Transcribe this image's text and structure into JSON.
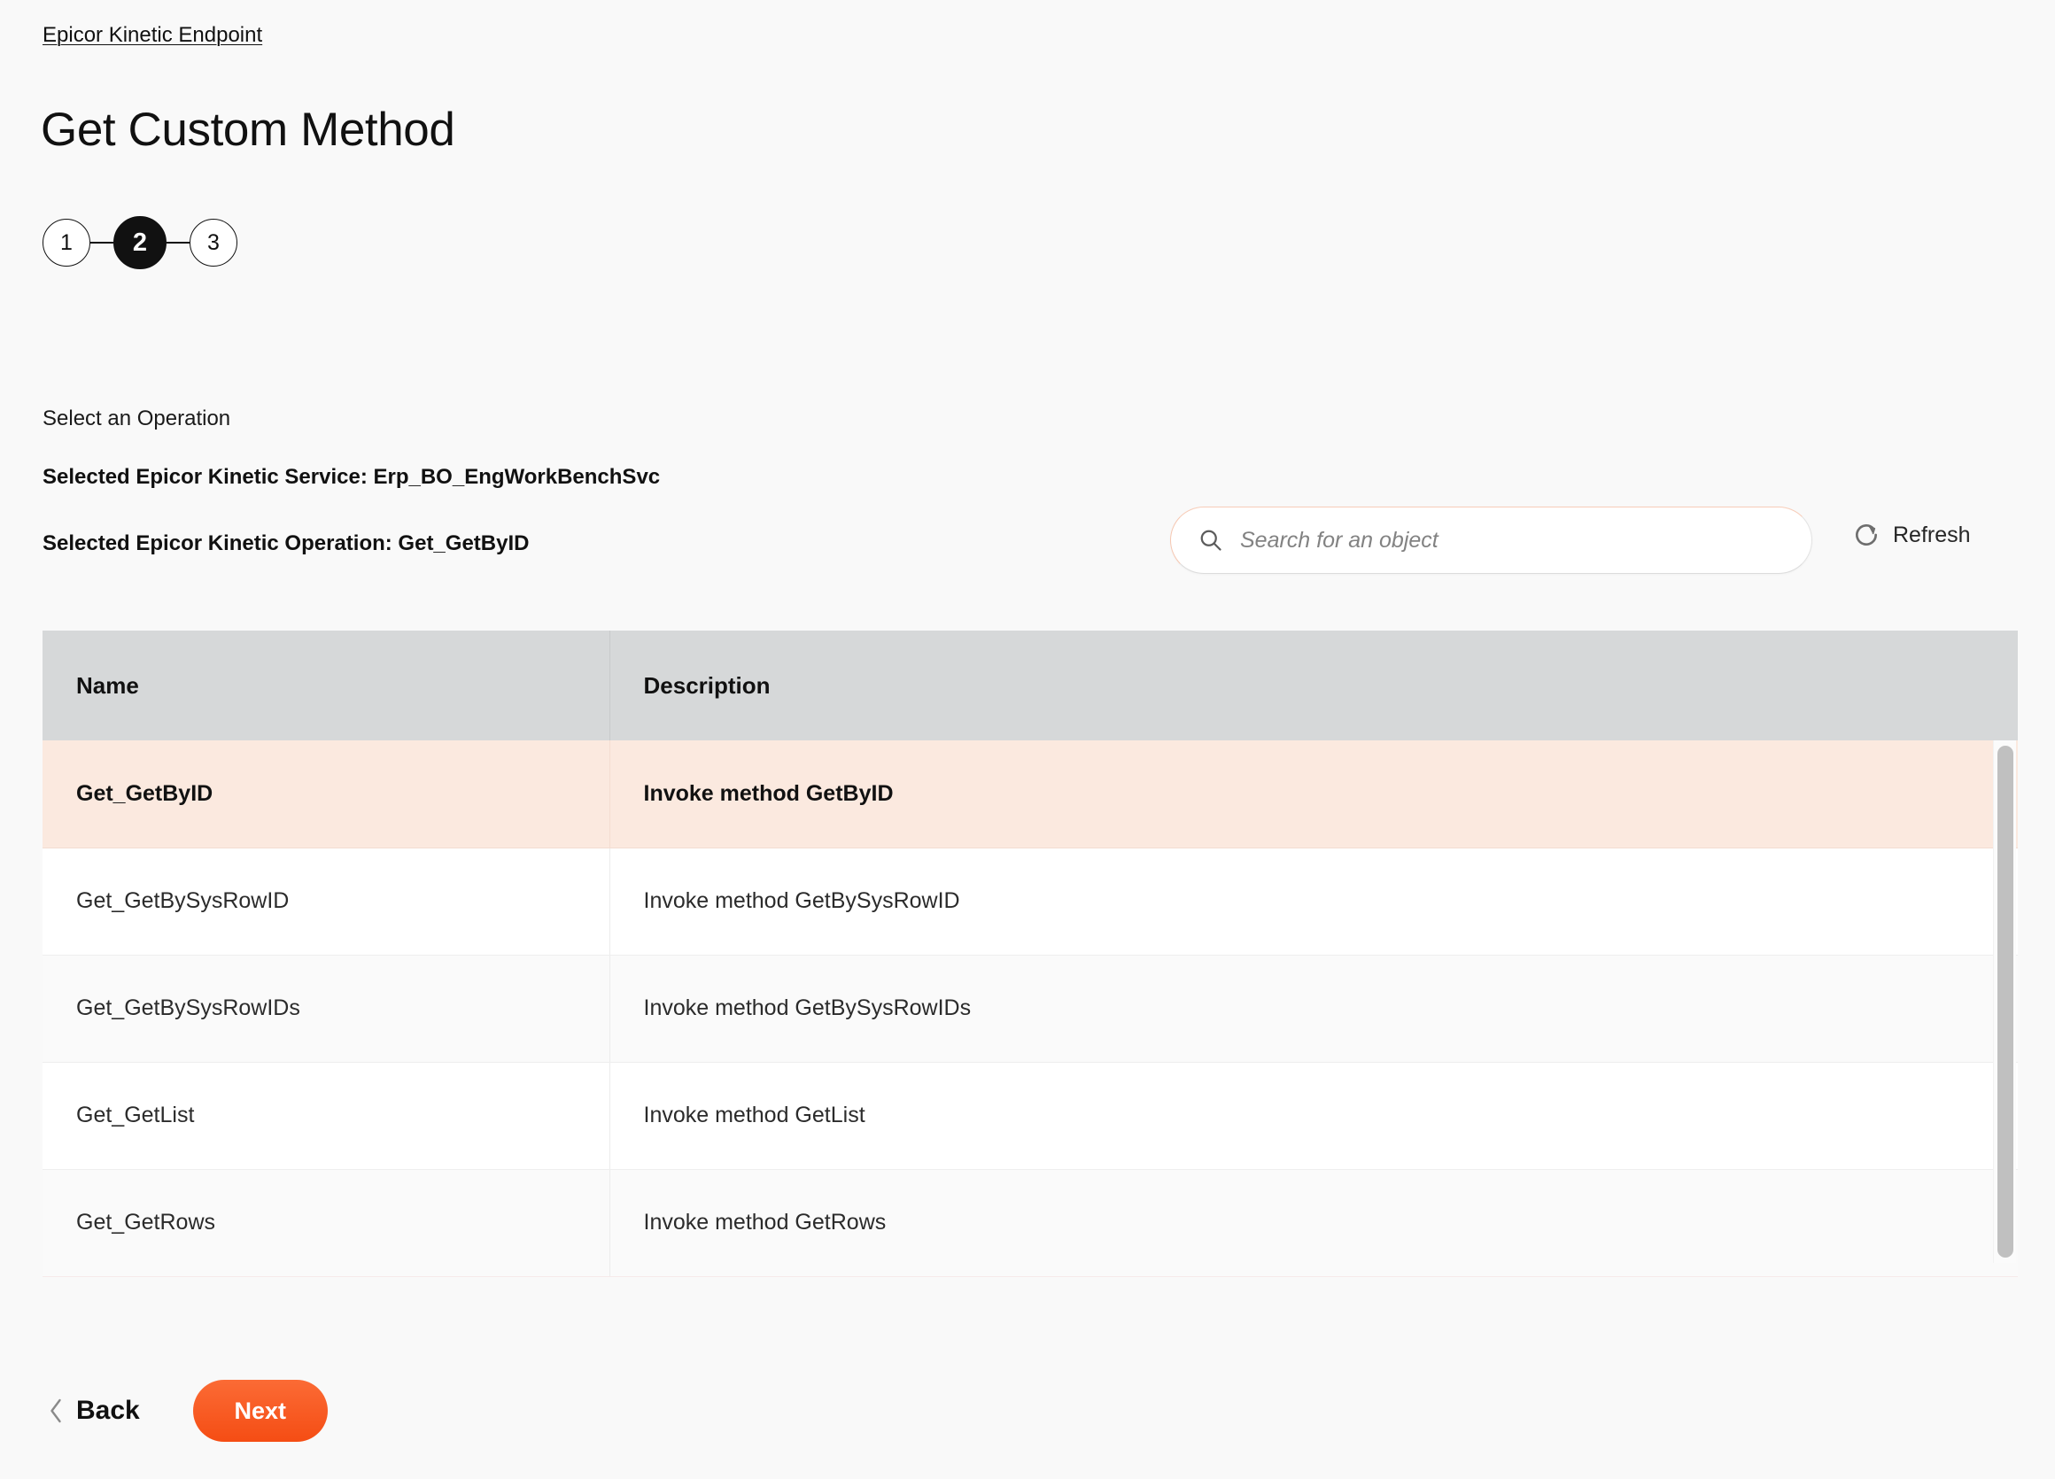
{
  "breadcrumb": {
    "label": "Epicor Kinetic Endpoint"
  },
  "page": {
    "title": "Get Custom Method"
  },
  "stepper": {
    "steps": [
      {
        "label": "1",
        "active": false
      },
      {
        "label": "2",
        "active": true
      },
      {
        "label": "3",
        "active": false
      }
    ]
  },
  "selection": {
    "prompt": "Select an Operation",
    "service_line": "Selected Epicor Kinetic Service: Erp_BO_EngWorkBenchSvc",
    "operation_line": "Selected Epicor Kinetic Operation: Get_GetByID"
  },
  "search": {
    "placeholder": "Search for an object",
    "value": "",
    "icon": "search-icon"
  },
  "refresh": {
    "label": "Refresh",
    "icon": "refresh-icon"
  },
  "table": {
    "columns": [
      "Name",
      "Description"
    ],
    "rows": [
      {
        "name": "Get_GetByID",
        "description": "Invoke method GetByID",
        "selected": true
      },
      {
        "name": "Get_GetBySysRowID",
        "description": "Invoke method GetBySysRowID",
        "selected": false
      },
      {
        "name": "Get_GetBySysRowIDs",
        "description": "Invoke method GetBySysRowIDs",
        "selected": false
      },
      {
        "name": "Get_GetList",
        "description": "Invoke method GetList",
        "selected": false
      },
      {
        "name": "Get_GetRows",
        "description": "Invoke method GetRows",
        "selected": false
      }
    ]
  },
  "footer": {
    "back_label": "Back",
    "back_icon": "chevron-left-icon",
    "next_label": "Next"
  },
  "colors": {
    "accent": "#f5511d",
    "selected_row": "#fbe9df",
    "header_row": "#d6d8d9",
    "page_background": "#f9f9f9",
    "search_border": "#f8cdb9"
  }
}
